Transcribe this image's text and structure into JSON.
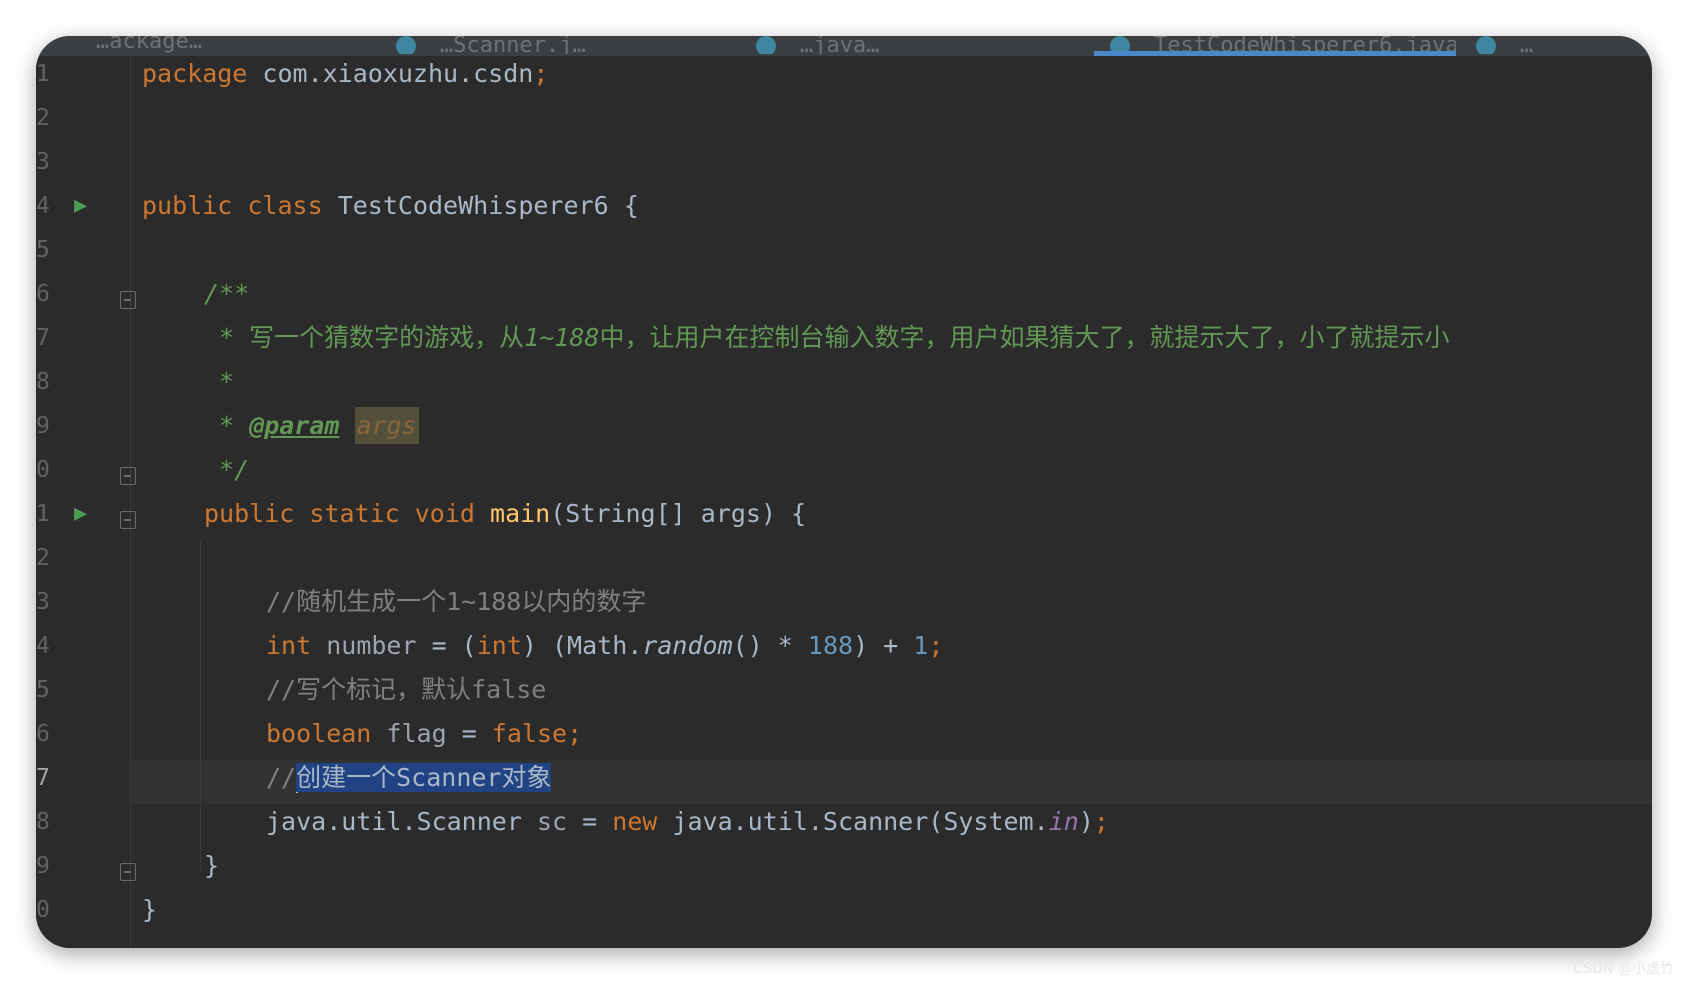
{
  "editor": {
    "tabs": [
      "…ackage…",
      "…Scanner.j…",
      "…java…",
      "TestCodeWhisperer6.java",
      "…"
    ],
    "active_tab_index": 3,
    "lines": [
      {
        "n": "1"
      },
      {
        "n": "2"
      },
      {
        "n": "3"
      },
      {
        "n": "4"
      },
      {
        "n": "5"
      },
      {
        "n": "6"
      },
      {
        "n": "7"
      },
      {
        "n": "8"
      },
      {
        "n": "9"
      },
      {
        "n": "0"
      },
      {
        "n": "1"
      },
      {
        "n": "2"
      },
      {
        "n": "3"
      },
      {
        "n": "4"
      },
      {
        "n": "5"
      },
      {
        "n": "6"
      },
      {
        "n": "7"
      },
      {
        "n": "8"
      },
      {
        "n": "9"
      },
      {
        "n": "0"
      }
    ],
    "current_line_index": 16,
    "code": {
      "l1": {
        "kw": "package",
        "rest": " com.xiaoxuzhu.csdn",
        "semi": ";"
      },
      "l4": {
        "kw1": "public",
        "kw2": "class",
        "name": "TestCodeWhisperer6",
        "brace": " {"
      },
      "l6": {
        "doc": "/**"
      },
      "l7": {
        "star": " * ",
        "text": "写一个猜数字的游戏，从",
        "range": "1~188",
        "text2": "中，让用户在控制台输入数字，用户如果猜大了，就提示大了，小了就提示小"
      },
      "l8": {
        "star": " *"
      },
      "l9": {
        "star": " * ",
        "tag": "@param",
        "param": "args"
      },
      "l10": {
        "end": " */"
      },
      "l11": {
        "kw1": "public",
        "kw2": "static",
        "kw3": "void",
        "fn": "main",
        "sig": "(String[] args) {"
      },
      "l13": {
        "comment": "//随机生成一个1~188以内的数字"
      },
      "l14": {
        "kw": "int",
        "var": "number",
        "eq": " = (",
        "cast": "int",
        "mid": ") (Math.",
        "method": "random",
        "call": "() * ",
        "n1": "188",
        "plus": ") + ",
        "n2": "1",
        "semi": ";"
      },
      "l15": {
        "comment": "//写个标记，默认false"
      },
      "l16": {
        "kw": "boolean",
        "var": "flag",
        "eq": " = ",
        "val": "false",
        "semi": ";"
      },
      "l17": {
        "slashes": "//",
        "selected": "创建一个Scanner对象"
      },
      "l18": {
        "type": "java.util.Scanner",
        "var": "sc",
        "eq": " = ",
        "kw": "new",
        "ctor": " java.util.Scanner(System.",
        "field": "in",
        "close": ")",
        "semi": ";"
      },
      "l19": {
        "brace": "}"
      },
      "l20": {
        "brace": "}"
      }
    }
  },
  "watermark": "CSDN @小虚竹"
}
